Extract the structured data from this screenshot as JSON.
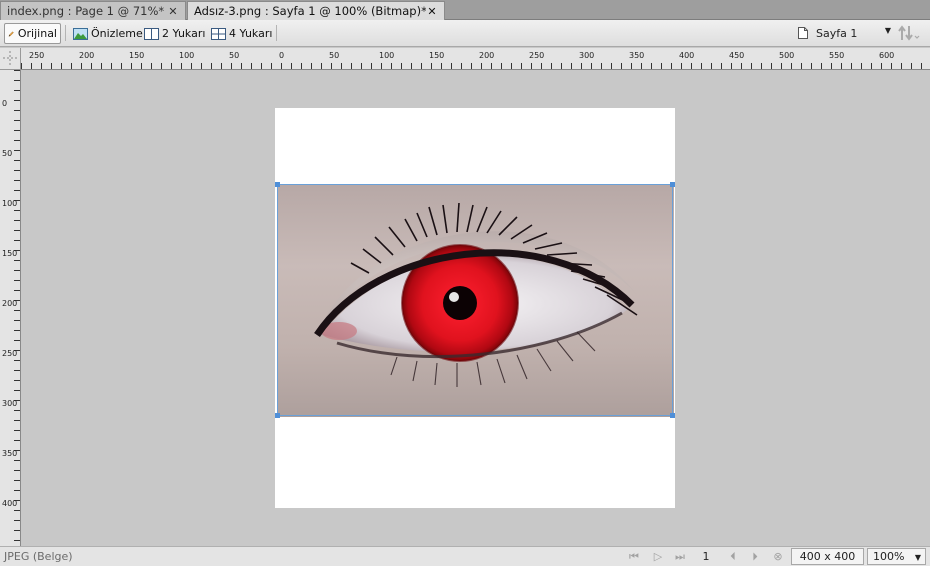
{
  "tabs": [
    {
      "label": "index.png : Page 1 @  71%*",
      "close": "✕"
    },
    {
      "label": "Adsız-3.png : Sayfa 1 @ 100% (Bitmap)*",
      "close": "✕"
    }
  ],
  "toolbar": {
    "original_label": "Orijinal",
    "preview_label": "Önizleme",
    "two_up_label": "2 Yukarı",
    "four_up_label": "4 Yukarı",
    "page_select_value": "Sayfa 1"
  },
  "ruler": {
    "top_labels": [
      "250",
      "200",
      "150",
      "100",
      "50",
      "0",
      "50",
      "100",
      "150",
      "200",
      "250",
      "300",
      "350",
      "400",
      "450",
      "500",
      "550",
      "600"
    ],
    "left_labels": [
      "0",
      "50",
      "100",
      "150",
      "200",
      "250",
      "300",
      "350",
      "400"
    ]
  },
  "status": {
    "doc_type": "JPEG (Belge)",
    "page_number": "1",
    "size": "400 x 400",
    "zoom": "100%"
  },
  "colors": {
    "iris": "#e0121e",
    "selection": "#4f8fd8"
  }
}
